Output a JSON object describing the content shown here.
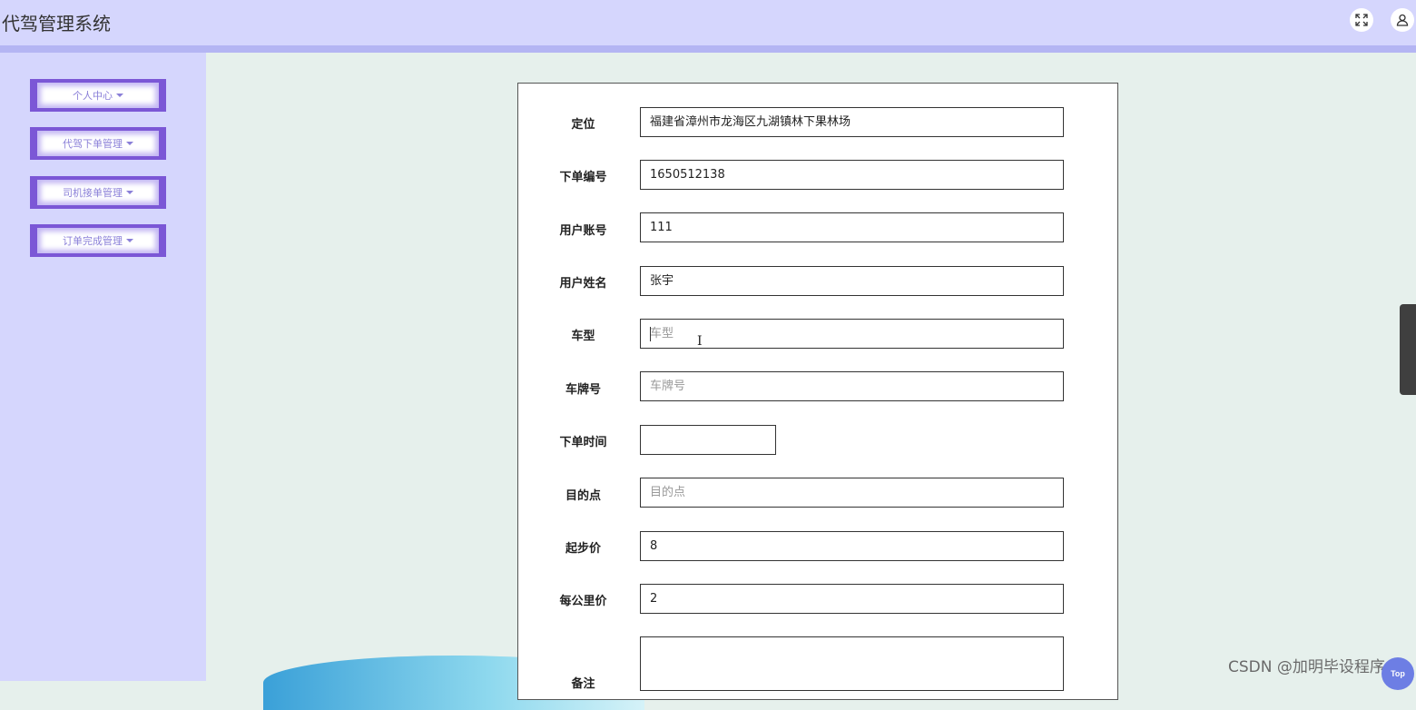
{
  "header": {
    "title": "代驾管理系统"
  },
  "sidebar": {
    "items": [
      {
        "label": "个人中心"
      },
      {
        "label": "代驾下单管理"
      },
      {
        "label": "司机接单管理"
      },
      {
        "label": "订单完成管理"
      }
    ]
  },
  "form": {
    "location": {
      "label": "定位",
      "value": "福建省漳州市龙海区九湖镇林下果林场"
    },
    "order_no": {
      "label": "下单编号",
      "value": "1650512138"
    },
    "user_account": {
      "label": "用户账号",
      "value": "111"
    },
    "user_name": {
      "label": "用户姓名",
      "value": "张宇"
    },
    "car_model": {
      "label": "车型",
      "placeholder": "车型"
    },
    "plate_no": {
      "label": "车牌号",
      "placeholder": "车牌号"
    },
    "order_time": {
      "label": "下单时间",
      "value": ""
    },
    "destination": {
      "label": "目的点",
      "placeholder": "目的点"
    },
    "base_price": {
      "label": "起步价",
      "value": "8"
    },
    "per_km_price": {
      "label": "每公里价",
      "value": "2"
    },
    "remark": {
      "label": "备注",
      "value": ""
    }
  },
  "watermark": "CSDN @加明毕设程序",
  "top_button": "Top",
  "icons": {
    "fullscreen": "fullscreen-icon",
    "user": "user-icon"
  }
}
